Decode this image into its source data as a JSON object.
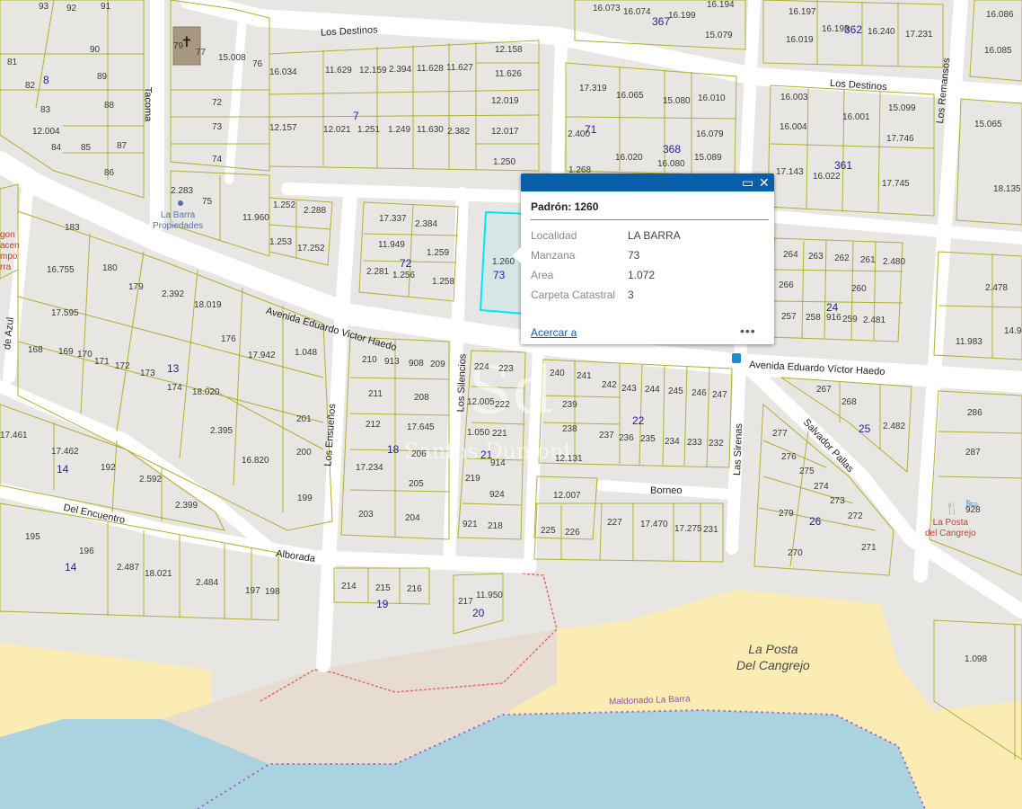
{
  "colors": {
    "background": "#e8e6e2",
    "road": "#ffffff",
    "parcel_outline": "#b5ad2e",
    "water": "#aad3df",
    "sand": "#fbecb4",
    "rocks": "#e6dcd2",
    "highlight": "#00e5ff",
    "popup_header": "#0a5ea8",
    "block_number": "#1f1fa0"
  },
  "streets": {
    "los_destinos_w": "Los Destinos",
    "los_destinos_e": "Los Destinos",
    "los_remansos": "Los Remansos",
    "tacoma": "Tacoma",
    "av_haedo_w": "Avenida Eduardo Victor Haedo",
    "av_haedo_e": "Avenida Eduardo Víctor Haedo",
    "los_ensuenos": "Los Ensueños",
    "los_silencios": "Los Silencios",
    "las_sirenas": "Las Sirenas",
    "salvador_pallas": "Salvador Pallas",
    "borneo": "Borneo",
    "del_encuentro": "Del Encuentro",
    "alborada": "Alborada",
    "de_azul": "de Azul"
  },
  "pois": {
    "la_barra_propiedades_line1": "La Barra",
    "la_barra_propiedades_line2": "Propiedades",
    "la_posta_line1": "La Posta",
    "la_posta_line2": "del Cangrejo",
    "beach_line1": "La Posta",
    "beach_line2": "Del Cangrejo",
    "boundary": "Maldonado La Barra",
    "left_cut_1": "gon",
    "left_cut_2": "acen",
    "left_cut_3": "mpo",
    "left_cut_4": "rra",
    "church_num": "79",
    "poi_num": "928"
  },
  "watermark": {
    "logo": "Sd",
    "name": "Santos Dumont"
  },
  "popup": {
    "title": "Padrón: 1260",
    "fields": [
      {
        "key": "Localidad",
        "value": "LA BARRA"
      },
      {
        "key": "Manzana",
        "value": "73"
      },
      {
        "key": "Area",
        "value": "1.072"
      },
      {
        "key": "Carpeta Catastral",
        "value": "3"
      }
    ],
    "zoom_link": "Acercar a",
    "more": "•••",
    "maximize_icon": "maximize-icon",
    "close_icon": "close-icon"
  },
  "block_numbers": [
    "8",
    "7",
    "367",
    "362",
    "71",
    "368",
    "361",
    "72",
    "73",
    "24",
    "13",
    "18",
    "21",
    "22",
    "25",
    "14",
    "14",
    "19",
    "20",
    "26"
  ],
  "lot_numbers": [
    "93",
    "92",
    "91",
    "81",
    "90",
    "82",
    "89",
    "83",
    "88",
    "12.004",
    "84",
    "85",
    "87",
    "86",
    "77",
    "15.008",
    "76",
    "72",
    "73",
    "74",
    "2.283",
    "75",
    "11.960",
    "16.034",
    "11.629",
    "12.159",
    "2.394",
    "11.628",
    "11.627",
    "12.158",
    "11.626",
    "12.157",
    "12.021",
    "1.251",
    "1.249",
    "11.630",
    "2.382",
    "12.019",
    "12.017",
    "1.250",
    "16.073",
    "16.074",
    "16.199",
    "16.194",
    "15.079",
    "17.319",
    "16.065",
    "15.080",
    "16.010",
    "2.400",
    "16.079",
    "16.020",
    "16.080",
    "15.089",
    "1.268",
    "16.197",
    "16.019",
    "16.198",
    "16.240",
    "17.231",
    "16.003",
    "16.001",
    "15.099",
    "16.004",
    "17.746",
    "17.143",
    "16.022",
    "17.745",
    "16.086",
    "16.085",
    "15.065",
    "18.135",
    "1.252",
    "2.288",
    "1.253",
    "17.252",
    "17.337",
    "2.384",
    "11.949",
    "1.259",
    "2.281",
    "1.256",
    "1.258",
    "1.260",
    "183",
    "16.755",
    "180",
    "179",
    "2.392",
    "18.019",
    "17.595",
    "176",
    "168",
    "169",
    "170",
    "171",
    "172",
    "173",
    "174",
    "18.020",
    "17.942",
    "1.048",
    "201",
    "2.395",
    "16.820",
    "200",
    "199",
    "17.461",
    "17.462",
    "192",
    "2.592",
    "2.399",
    "195",
    "196",
    "2.487",
    "18.021",
    "2.484",
    "197",
    "198",
    "210",
    "913",
    "908",
    "209",
    "211",
    "208",
    "212",
    "17.645",
    "17.234",
    "206",
    "205",
    "203",
    "204",
    "224",
    "223",
    "12.005",
    "222",
    "1.050",
    "221",
    "914",
    "219",
    "924",
    "921",
    "218",
    "240",
    "241",
    "242",
    "243",
    "244",
    "245",
    "246",
    "247",
    "239",
    "238",
    "237",
    "236",
    "235",
    "234",
    "233",
    "232",
    "12.131",
    "12.007",
    "227",
    "17.470",
    "17.275",
    "231",
    "225",
    "226",
    "214",
    "215",
    "216",
    "217",
    "11.950",
    "264",
    "263",
    "262",
    "261",
    "2.480",
    "266",
    "260",
    "257",
    "258",
    "916",
    "259",
    "2.481",
    "267",
    "268",
    "2.482",
    "277",
    "276",
    "275",
    "274",
    "273",
    "279",
    "272",
    "270",
    "271",
    "2.478",
    "11.983",
    "14.9",
    "286",
    "287",
    "1.098"
  ]
}
